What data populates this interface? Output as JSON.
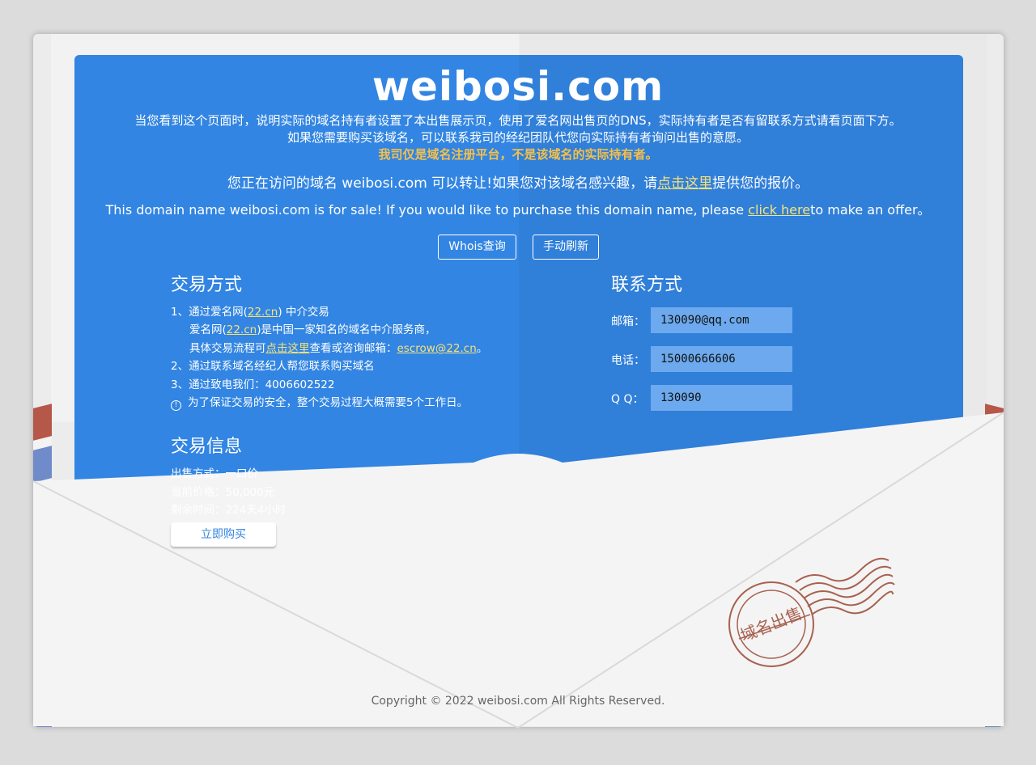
{
  "domain": "weibosi.com",
  "intro": {
    "line1": "当您看到这个页面时，说明实际的域名持有者设置了本出售展示页，使用了爱名网出售页的DNS，实际持有者是否有留联系方式请看页面下方。",
    "line2": "如果您需要购买该域名，可以联系我司的经纪团队代您向实际持有者询问出售的意愿。",
    "warning": "我司仅是域名注册平台，不是该域名的实际持有者。"
  },
  "offer_cn": {
    "before": "您正在访问的域名 weibosi.com 可以转让!如果您对该域名感兴趣，请",
    "link": "点击这里",
    "after": "提供您的报价。"
  },
  "offer_en": {
    "before": "This domain name weibosi.com is for sale! If you would like to purchase this domain name, please ",
    "link": "click here",
    "after": "to make an offer。"
  },
  "buttons": {
    "whois": "Whois查询",
    "refresh": "手动刷新"
  },
  "trade_method": {
    "title": "交易方式",
    "l1_before": "1、通过爱名网(",
    "l1_link": "22.cn",
    "l1_after": ") 中介交易",
    "l2_before": "爱名网(",
    "l2_link": "22.cn",
    "l2_after": ")是中国一家知名的域名中介服务商，",
    "l3_before": "具体交易流程可",
    "l3_link": "点击这里",
    "l3_mid": "查看或咨询邮箱：",
    "l3_email": "escrow@22.cn",
    "l3_after": "。",
    "l4": "2、通过联系域名经纪人帮您联系购买域名",
    "l5": "3、通过致电我们：4006602522",
    "l6": "为了保证交易的安全，整个交易过程大概需要5个工作日。"
  },
  "trade_info": {
    "title": "交易信息",
    "sale_mode": "出售方式：一口价",
    "price": "当前价格：50,000元",
    "remaining": "剩余时间：224天4小时",
    "buy_button": "立即购买"
  },
  "contact": {
    "title": "联系方式",
    "email_label": "邮箱：",
    "email": "130090@qq.com",
    "phone_label": "电话：",
    "phone": "15000666606",
    "qq_label": "Q Q：",
    "qq": "130090"
  },
  "stamp_text": "域名出售",
  "copyright": "Copyright © 2022 weibosi.com All Rights Reserved.",
  "colors": {
    "card_blue": "#3285e2",
    "link_yellow": "#f5e27a",
    "warning_orange": "#f5c04a",
    "stamp_brown": "#a8614f"
  }
}
